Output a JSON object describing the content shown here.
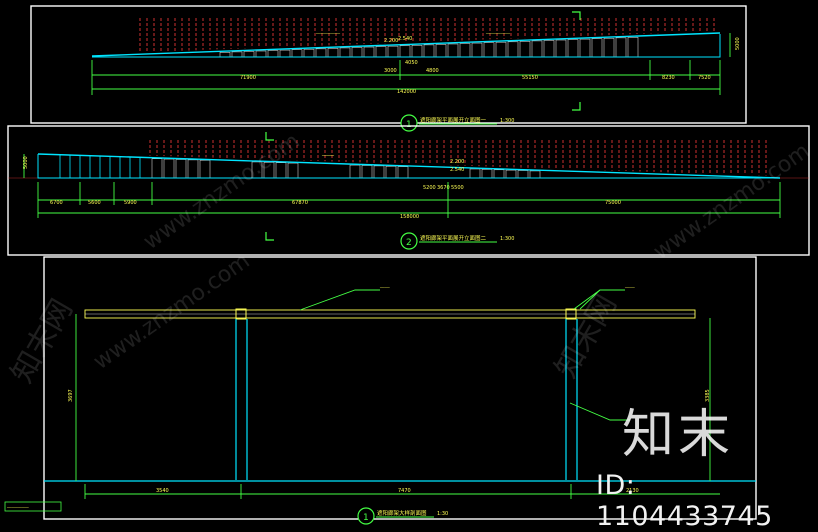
{
  "drawing": {
    "colors": {
      "background": "#000000",
      "frame": "#ffffff",
      "slope": "#00e5ff",
      "rafter": "#ff3b3b",
      "dimension": "#44ff44",
      "text": "#ffff55",
      "hatch": "#cfcfcf"
    }
  },
  "elevation1": {
    "dims": [
      "71900",
      "55150",
      "8230",
      "7520"
    ],
    "total": "142000",
    "height": "5000",
    "notes": [
      "2.200",
      "2.540",
      "4050",
      "3000",
      "4800"
    ],
    "marker": "1",
    "title": "遮阳廊架平面展开立面图一",
    "scale": "1:300"
  },
  "elevation2": {
    "dims": [
      "6700",
      "5600",
      "5900",
      "67870",
      "75000"
    ],
    "total": "158000",
    "height": "5000",
    "notes": [
      "2.200",
      "2.540",
      "5200",
      "3670",
      "5500"
    ],
    "marker": "2",
    "title": "遮阳廊架平面展开立面图二",
    "scale": "1:300"
  },
  "section": {
    "left_height": "3697",
    "right_height": "3385",
    "bottom_dims": [
      "3540",
      "7470",
      "2130"
    ],
    "marker": "1",
    "title": "遮阳廊架大样剖面图",
    "scale": "1:30"
  },
  "watermark": {
    "site": "www.znzmo.com",
    "brand": "知末网",
    "logo": "知末",
    "id": "ID: 1104433745"
  }
}
